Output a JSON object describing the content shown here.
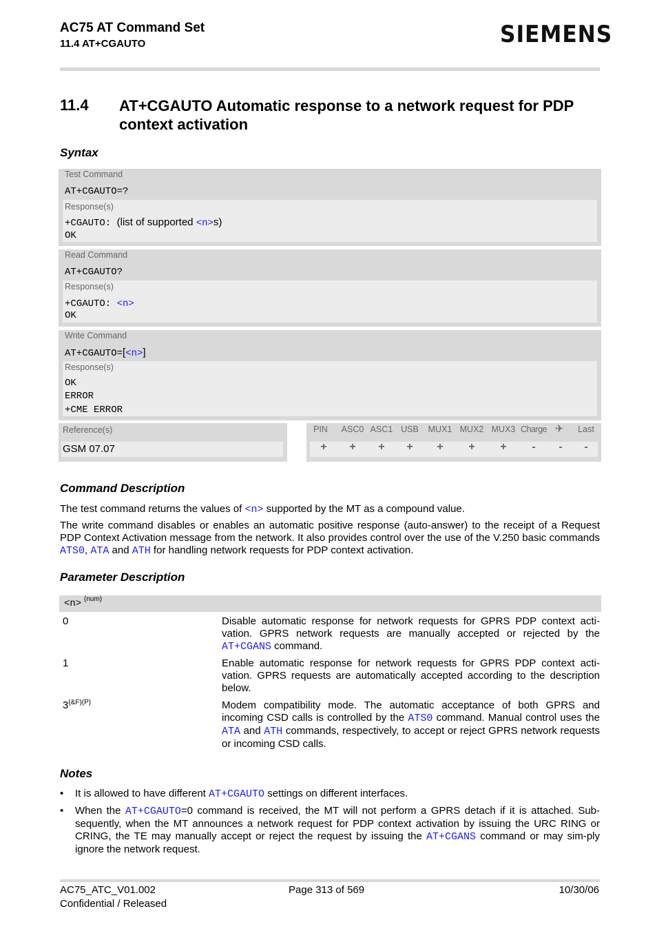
{
  "header": {
    "doc_title": "AC75 AT Command Set",
    "section_ref": "11.4 AT+CGAUTO",
    "logo": "SIEMENS"
  },
  "section": {
    "number": "11.4",
    "title": "AT+CGAUTO   Automatic response to a network request for PDP context activation"
  },
  "syntax": {
    "heading": "Syntax",
    "test": {
      "label": "Test Command",
      "command": "AT+CGAUTO=?",
      "response_label": "Response(s)",
      "response_prefix": "+CGAUTO: ",
      "response_text1": "(list of supported ",
      "response_param": "<n>",
      "response_text2": "s)",
      "response_ok": "OK"
    },
    "read": {
      "label": "Read Command",
      "command": "AT+CGAUTO?",
      "response_label": "Response(s)",
      "response_prefix": "+CGAUTO: ",
      "response_param": "<n>",
      "response_ok": "OK"
    },
    "write": {
      "label": "Write Command",
      "command_prefix": "AT+CGAUTO=",
      "bracket_open": "[",
      "command_param": "<n>",
      "bracket_close": "]",
      "response_label": "Response(s)",
      "responses": [
        "OK",
        "ERROR",
        "+CME ERROR"
      ]
    },
    "reference": {
      "label": "Reference(s)",
      "value": "GSM 07.07"
    },
    "flags": {
      "headers": [
        "PIN",
        "ASC0",
        "ASC1",
        "USB",
        "MUX1",
        "MUX2",
        "MUX3",
        "Charge",
        "✈",
        "Last"
      ],
      "values": [
        "+",
        "+",
        "+",
        "+",
        "+",
        "+",
        "+",
        "-",
        "-",
        "-"
      ]
    }
  },
  "command_description": {
    "heading": "Command Description",
    "p1_a": "The test command returns the values of ",
    "p1_param": "<n>",
    "p1_b": " supported by the MT as a compound value.",
    "p2_a": "The write command disables or enables an automatic positive response (auto-answer) to the receipt of a Request PDP Context Activation message from the network. It also provides control over the use of the V.250 basic commands ",
    "p2_link1": "ATS0",
    "p2_sep": ", ",
    "p2_link2": "ATA",
    "p2_and": " and ",
    "p2_link3": "ATH",
    "p2_b": " for handling network requests for PDP context activation."
  },
  "parameter_description": {
    "heading": "Parameter Description",
    "param_name": "<n>",
    "param_type": "(num)",
    "values": [
      {
        "value": "0",
        "desc_a": "Disable automatic response for network requests for GPRS PDP context acti-vation. GPRS network requests are manually accepted or rejected by the ",
        "link": "AT+CGANS",
        "desc_b": " command."
      },
      {
        "value": "1",
        "desc": "Enable automatic response for network requests for GPRS PDP context acti-vation. GPRS requests are automatically accepted according to the description below."
      },
      {
        "value": "3",
        "value_sup": "(&F)(P)",
        "desc_a": "Modem compatibility mode. The automatic acceptance of both GPRS and incoming CSD calls is controlled by the ",
        "link1": "ATS0",
        "desc_b": " command. Manual control uses the ",
        "link2": "ATA",
        "desc_and": " and ",
        "link3": "ATH",
        "desc_c": " commands, respectively, to accept or reject GPRS network requests or incoming CSD calls."
      }
    ]
  },
  "notes": {
    "heading": "Notes",
    "bullet": "•",
    "n1_a": "It is allowed to have different ",
    "n1_link": "AT+CGAUTO",
    "n1_b": " settings on different interfaces.",
    "n2_a": "When the ",
    "n2_link1": "AT+CGAUTO",
    "n2_b": "=0 command is received, the MT will not perform a GPRS detach if it is attached. Sub-sequently, when the MT announces a network request for PDP context activation by issuing the URC RING or CRING, the TE may manually accept or reject the request by issuing the ",
    "n2_link2": "AT+CGANS",
    "n2_c": " command or may sim-ply ignore the network request."
  },
  "footer": {
    "doc_id": "AC75_ATC_V01.002",
    "status": "Confidential / Released",
    "page": "Page 313 of 569",
    "date": "10/30/06"
  },
  "colors": {
    "link": "#1a1aff",
    "block_bg": "#d9d9d9",
    "response_bg": "#ececec"
  }
}
